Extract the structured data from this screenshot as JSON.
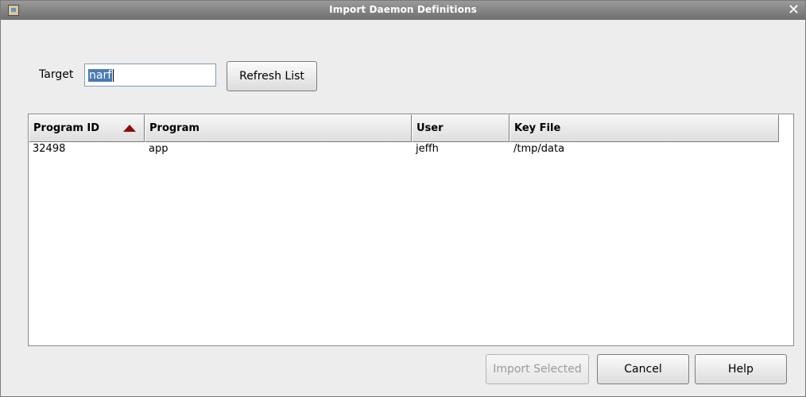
{
  "window": {
    "title": "Import Daemon Definitions",
    "close_glyph": "✕"
  },
  "target": {
    "label": "Target",
    "value": "narf"
  },
  "refresh_button": "Refresh List",
  "table": {
    "columns": [
      "Program ID",
      "Program",
      "User",
      "Key File"
    ],
    "sort_column": "Program ID",
    "sort_direction": "ascending",
    "rows": [
      [
        "32498",
        "app",
        "jeffh",
        "/tmp/data"
      ]
    ]
  },
  "buttons": {
    "import_selected": "Import Selected",
    "cancel": "Cancel",
    "help": "Help"
  },
  "icons": {
    "window_icon": "app-window-icon",
    "close": "close-icon",
    "sort": "sort-ascending-icon"
  },
  "colors": {
    "sort_arrow": "#8b0c0c",
    "selection": "#4a7ab5",
    "titlebar": "#7e7e7e"
  }
}
